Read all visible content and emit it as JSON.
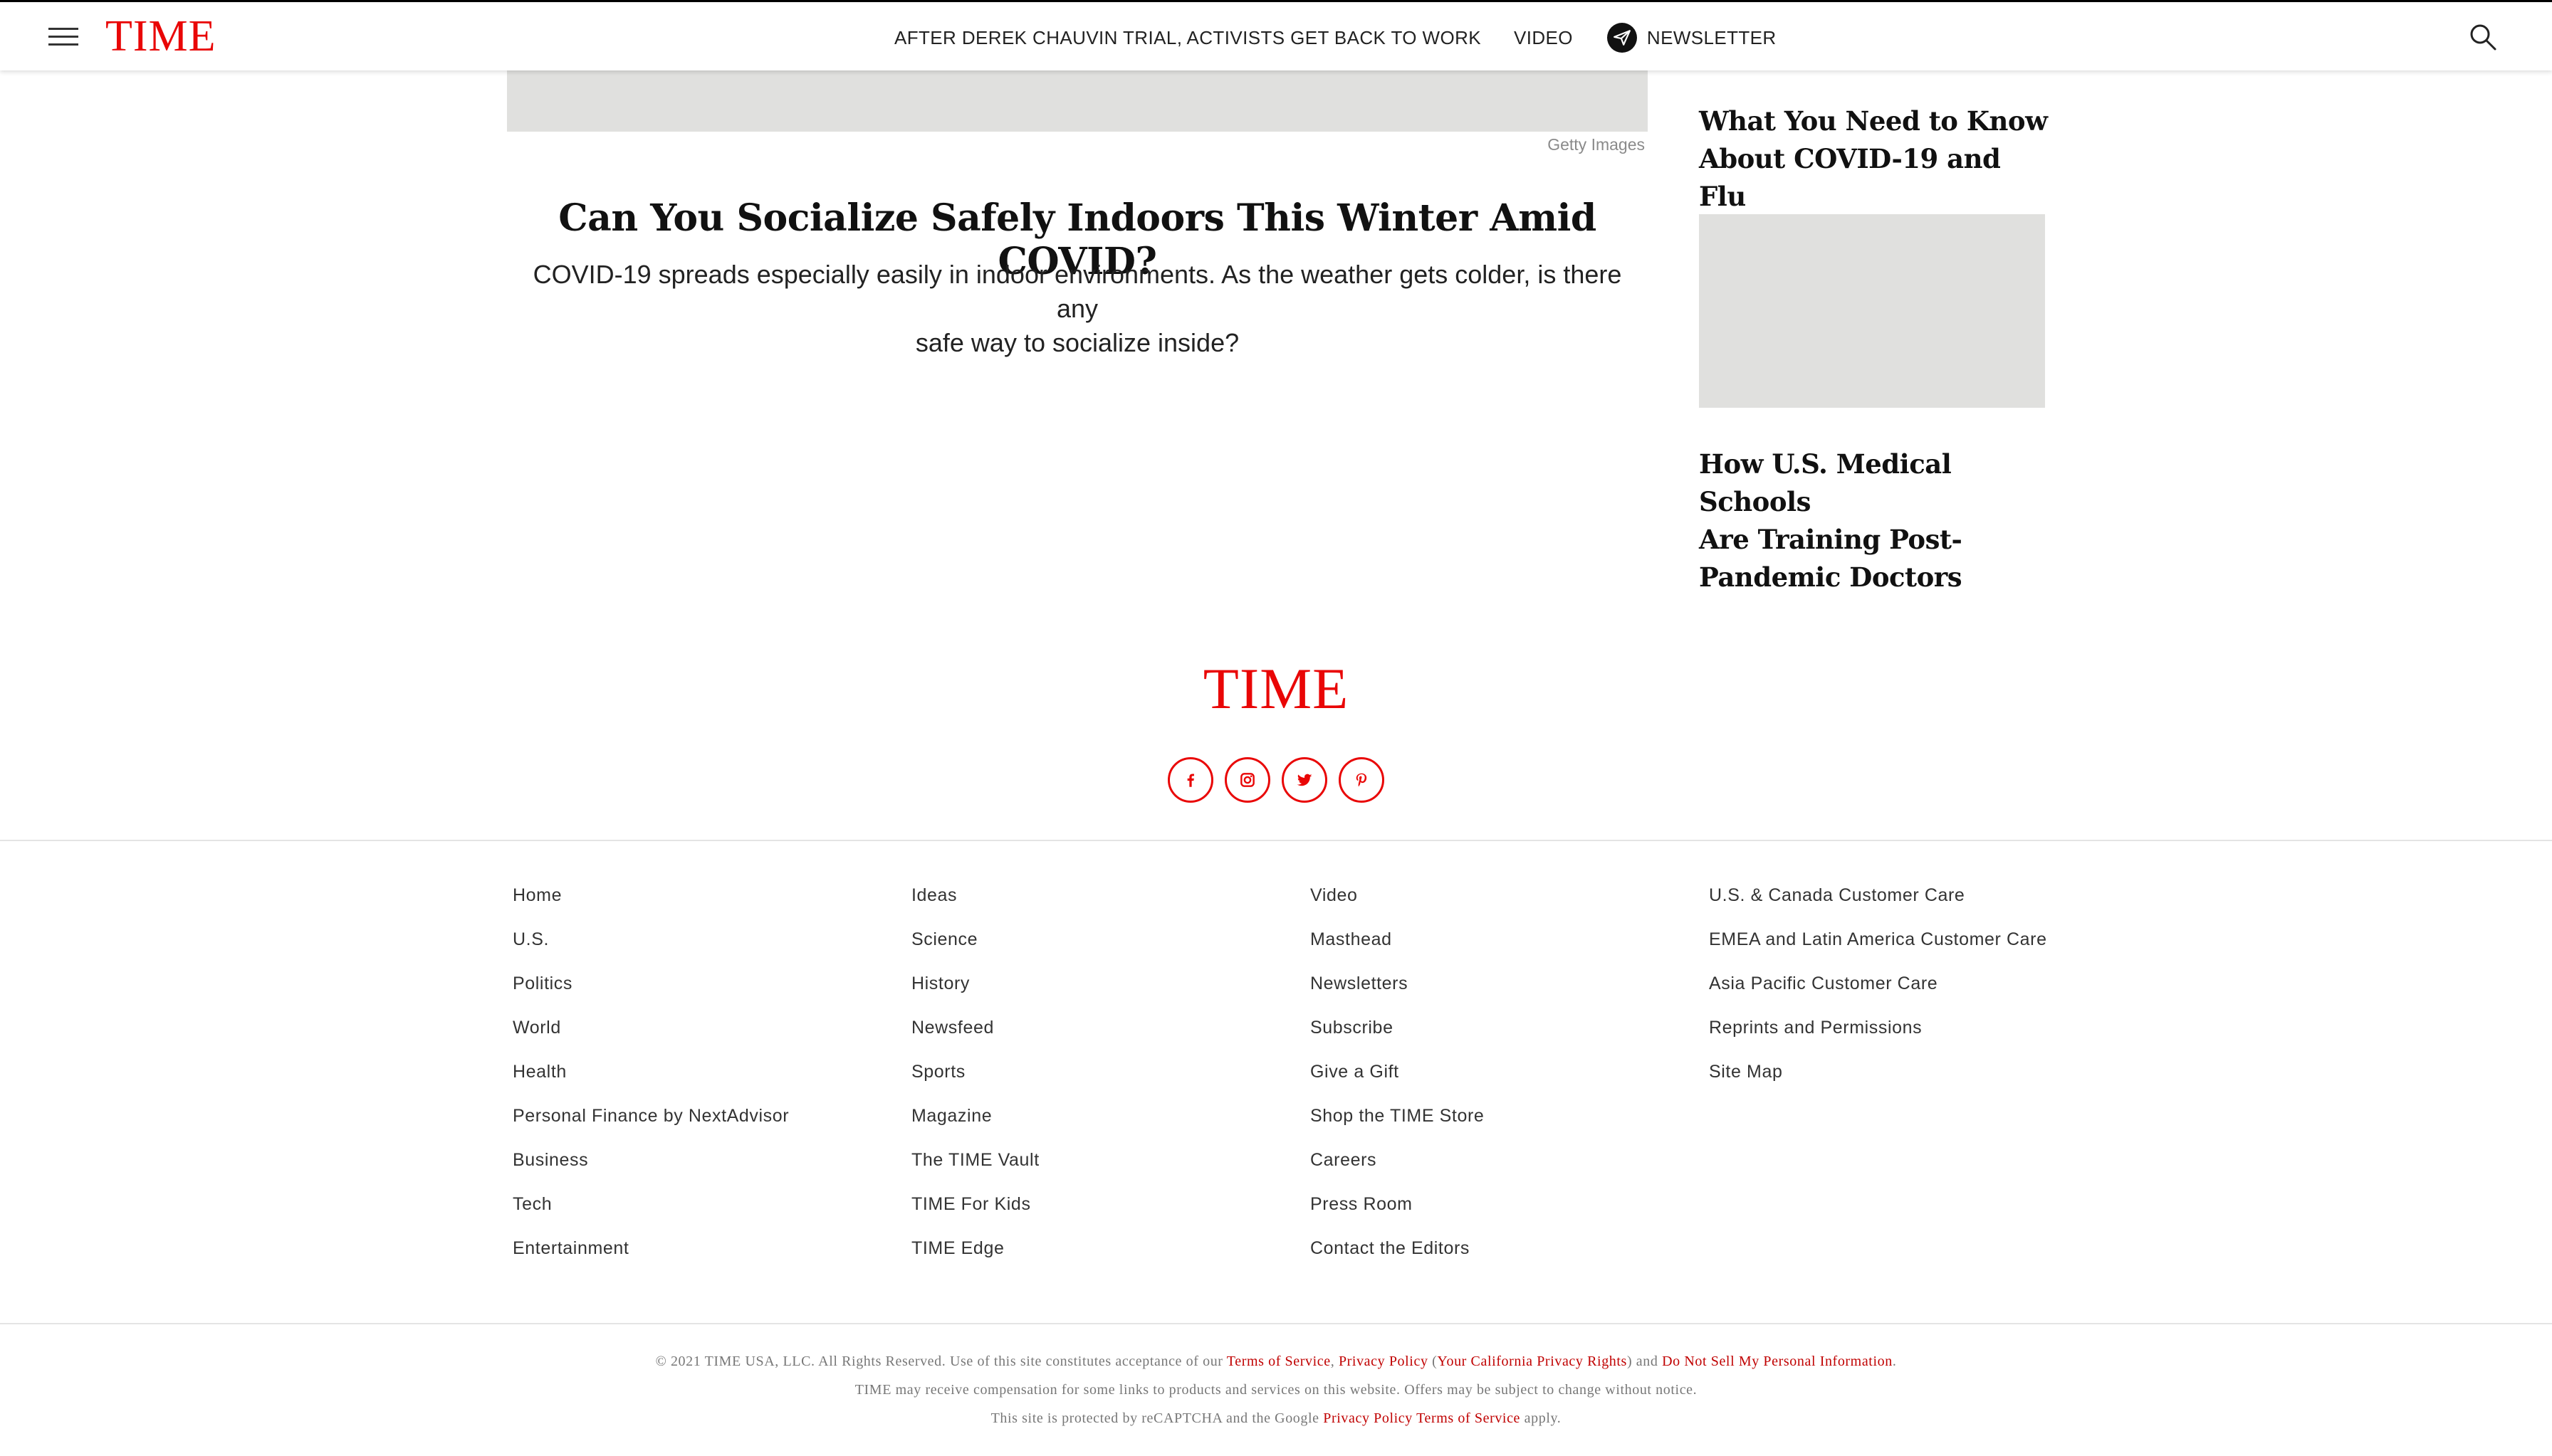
{
  "header": {
    "logo": "TIME",
    "nav": {
      "trial_link": "AFTER DEREK CHAUVIN TRIAL, ACTIVISTS GET BACK TO WORK",
      "video_link": "VIDEO",
      "newsletter_link": "NEWSLETTER"
    }
  },
  "article": {
    "image_credit": "Getty Images",
    "title": "Can You Socialize Safely Indoors This Winter Amid COVID?",
    "dek_line1": "COVID-19 spreads especially easily in indoor environments. As the weather gets colder, is there any",
    "dek_line2": "safe way to socialize inside?"
  },
  "sidebar": {
    "items": [
      {
        "title_line1": "What You Need to Know",
        "title_line2": "About COVID-19 and Flu"
      },
      {
        "title_line1": "How U.S. Medical Schools",
        "title_line2": "Are Training Post-",
        "title_line3": "Pandemic Doctors"
      }
    ]
  },
  "footer": {
    "logo": "TIME",
    "socials": [
      "facebook-icon",
      "instagram-icon",
      "twitter-icon",
      "pinterest-icon"
    ],
    "columns": [
      [
        "Home",
        "U.S.",
        "Politics",
        "World",
        "Health",
        "Personal Finance by NextAdvisor",
        "Business",
        "Tech",
        "Entertainment"
      ],
      [
        "Ideas",
        "Science",
        "History",
        "Newsfeed",
        "Sports",
        "Magazine",
        "The TIME Vault",
        "TIME For Kids",
        "TIME Edge"
      ],
      [
        "Video",
        "Masthead",
        "Newsletters",
        "Subscribe",
        "Give a Gift",
        "Shop the TIME Store",
        "Careers",
        "Press Room",
        "Contact the Editors"
      ],
      [
        "U.S. & Canada Customer Care",
        "EMEA and Latin America Customer Care",
        "Asia Pacific Customer Care",
        "Reprints and Permissions",
        "Site Map"
      ]
    ],
    "legal": {
      "line1_prefix": "© 2021 TIME USA, LLC. All Rights Reserved. Use of this site constitutes acceptance of our ",
      "terms": "Terms of Service",
      "comma": ", ",
      "privacy": "Privacy Policy",
      "paren_open": " (",
      "ca_rights": "Your California Privacy Rights",
      "paren_close_and": ") and ",
      "do_not_sell": "Do Not Sell My Personal Information",
      "period": ".",
      "line2": "TIME may receive compensation for some links to products and services on this website. Offers may be subject to change without notice.",
      "line3_prefix": "This site is protected by reCAPTCHA and the Google ",
      "google_privacy": "Privacy Policy",
      "space": " ",
      "google_terms": "Terms of Service",
      "line3_suffix": " apply."
    }
  },
  "colors": {
    "brand_red": "#e90606",
    "placeholder_gray": "#e0e0de"
  }
}
